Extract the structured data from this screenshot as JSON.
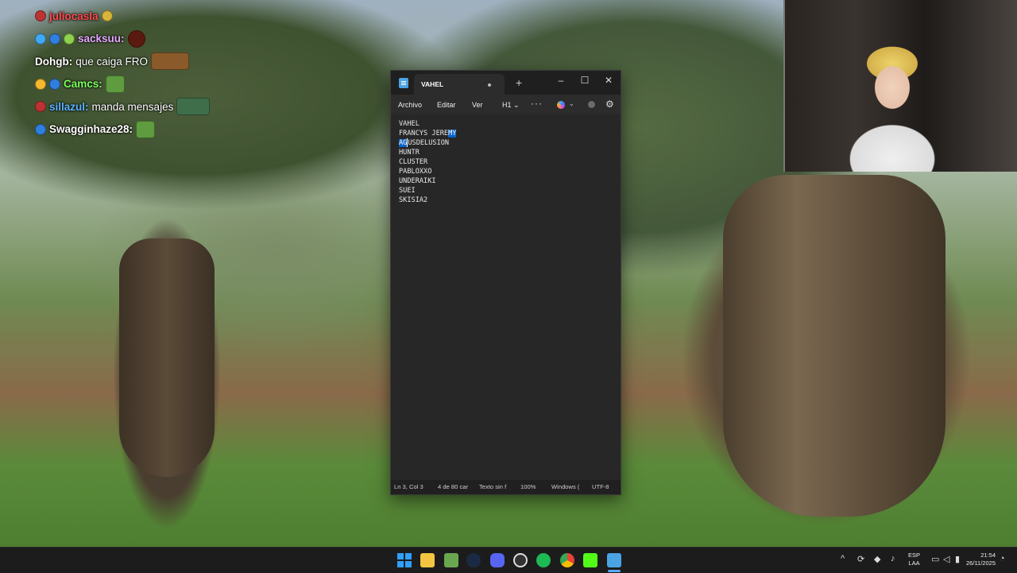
{
  "chat": {
    "messages": [
      {
        "user": "juliocasla",
        "text": "",
        "color": "#ff4b4b"
      },
      {
        "user": "sacksuu:",
        "text": "",
        "color": "#e6a8ff"
      },
      {
        "user": "Dohgb:",
        "text": "que caiga FRO",
        "color": "#ffffff"
      },
      {
        "user": "Camcs:",
        "text": "",
        "color": "#7dff5c"
      },
      {
        "user": "sillazul:",
        "text": "manda mensajes",
        "color": "#5cb3ff"
      },
      {
        "user": "Swagginhaze28:",
        "text": "",
        "color": "#ffffff"
      }
    ]
  },
  "notepad": {
    "tab_title": "VAHEL",
    "new_tab": "+",
    "window_controls": {
      "minimize": "–",
      "maximize": "☐",
      "close": "✕"
    },
    "menu": {
      "file": "Archivo",
      "edit": "Editar",
      "view": "Ver",
      "heading": "H1 ⌄",
      "more": "···",
      "copilot_chevron": "⌄",
      "settings": "⚙"
    },
    "lines": [
      {
        "pre": "VAHEL",
        "sel": "",
        "post": ""
      },
      {
        "pre": "FRANCYS JERE",
        "sel": "MY",
        "post": ""
      },
      {
        "pre": "",
        "sel": "AG",
        "post": "USDELUSION"
      },
      {
        "pre": "HUNTR",
        "sel": "",
        "post": ""
      },
      {
        "pre": "CLUSTER",
        "sel": "",
        "post": ""
      },
      {
        "pre": "PABLOXXO",
        "sel": "",
        "post": ""
      },
      {
        "pre": "UNDERAIKI",
        "sel": "",
        "post": ""
      },
      {
        "pre": "SUEI",
        "sel": "",
        "post": ""
      },
      {
        "pre": "SKISIA2",
        "sel": "",
        "post": ""
      }
    ],
    "status": {
      "position": "Ln 3, Col 3",
      "count": "4 de 80 car",
      "type": "Texto sin f",
      "zoom": "100%",
      "eol": "Windows (",
      "encoding": "UTF-8"
    }
  },
  "taskbar": {
    "tray": {
      "chevron": "^",
      "language_top": "ESP",
      "language_bottom": "LAA",
      "time": "21:54",
      "date": "26/11/2025"
    }
  },
  "colors": {
    "selection": "#0a64c8",
    "accent": "#5aa9ff"
  }
}
